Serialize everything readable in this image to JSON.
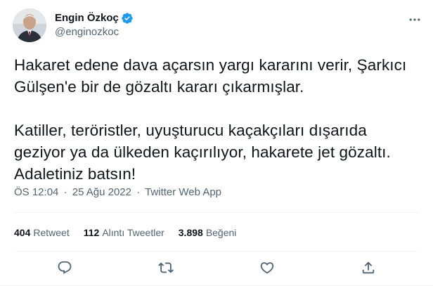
{
  "author": {
    "name": "Engin Özkoç",
    "handle": "@enginozkoc",
    "verified": true
  },
  "tweet": {
    "paragraph1": "Hakaret edene dava açarsın yargı kararını verir, Şarkıcı Gülşen'e bir de gözaltı kararı çıkarmışlar.",
    "paragraph2": "Katiller, teröristler, uyuşturucu kaçakçıları dışarıda geziyor ya da ülkeden kaçırılıyor, hakarete jet gözaltı. Adaletiniz batsın!"
  },
  "meta": {
    "time": "ÖS 12:04",
    "separator": "·",
    "date": "25 Ağu 2022",
    "source": "Twitter Web App"
  },
  "stats": {
    "retweets_count": "404",
    "retweets_label": "Retweet",
    "quotes_count": "112",
    "quotes_label": "Alıntı Tweetler",
    "likes_count": "3.898",
    "likes_label": "Beğeni"
  },
  "icons": {
    "more": "more-dots-icon",
    "reply": "reply-icon",
    "retweet": "retweet-icon",
    "like": "heart-icon",
    "share": "share-icon",
    "verified": "verified-badge-icon"
  },
  "colors": {
    "text": "#0f1419",
    "secondary": "#536471",
    "verified": "#1d9bf0",
    "divider": "#eff3f4"
  }
}
